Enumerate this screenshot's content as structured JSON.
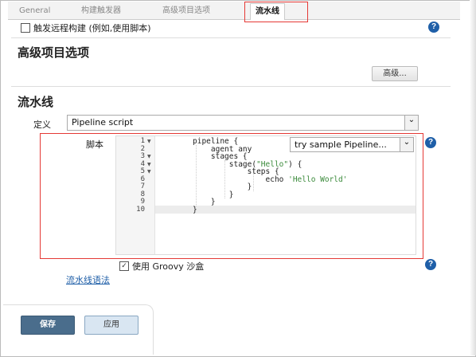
{
  "tabs": [
    "General",
    "构建触发器",
    "高级项目选项",
    "流水线"
  ],
  "trigger_remote": {
    "label": "触发远程构建 (例如,使用脚本)"
  },
  "advanced_section": {
    "title": "高级项目选项",
    "button": "高级..."
  },
  "pipeline_section": {
    "title": "流水线"
  },
  "definition": {
    "label": "定义",
    "value": "Pipeline script"
  },
  "script": {
    "label": "脚本",
    "sample_select": "try sample Pipeline...",
    "line_numbers": [
      "1",
      "2",
      "3",
      "4",
      "5",
      "6",
      "7",
      "8",
      "9",
      "10"
    ],
    "lines": [
      "pipeline {",
      "    agent any",
      "    stages {",
      "        stage(\"Hello\") {",
      "            steps {",
      "                echo 'Hello World'",
      "            }",
      "        }",
      "    }",
      "}"
    ]
  },
  "groovy_sandbox": {
    "label": "使用 Groovy 沙盒",
    "checked": true
  },
  "pipeline_syntax_link": "流水线语法",
  "buttons": {
    "save": "保存",
    "apply": "应用"
  },
  "help_icon": "?",
  "colors": {
    "accent": "#1f5fa8",
    "highlight": "#e53935",
    "save": "#4a6d8c"
  }
}
